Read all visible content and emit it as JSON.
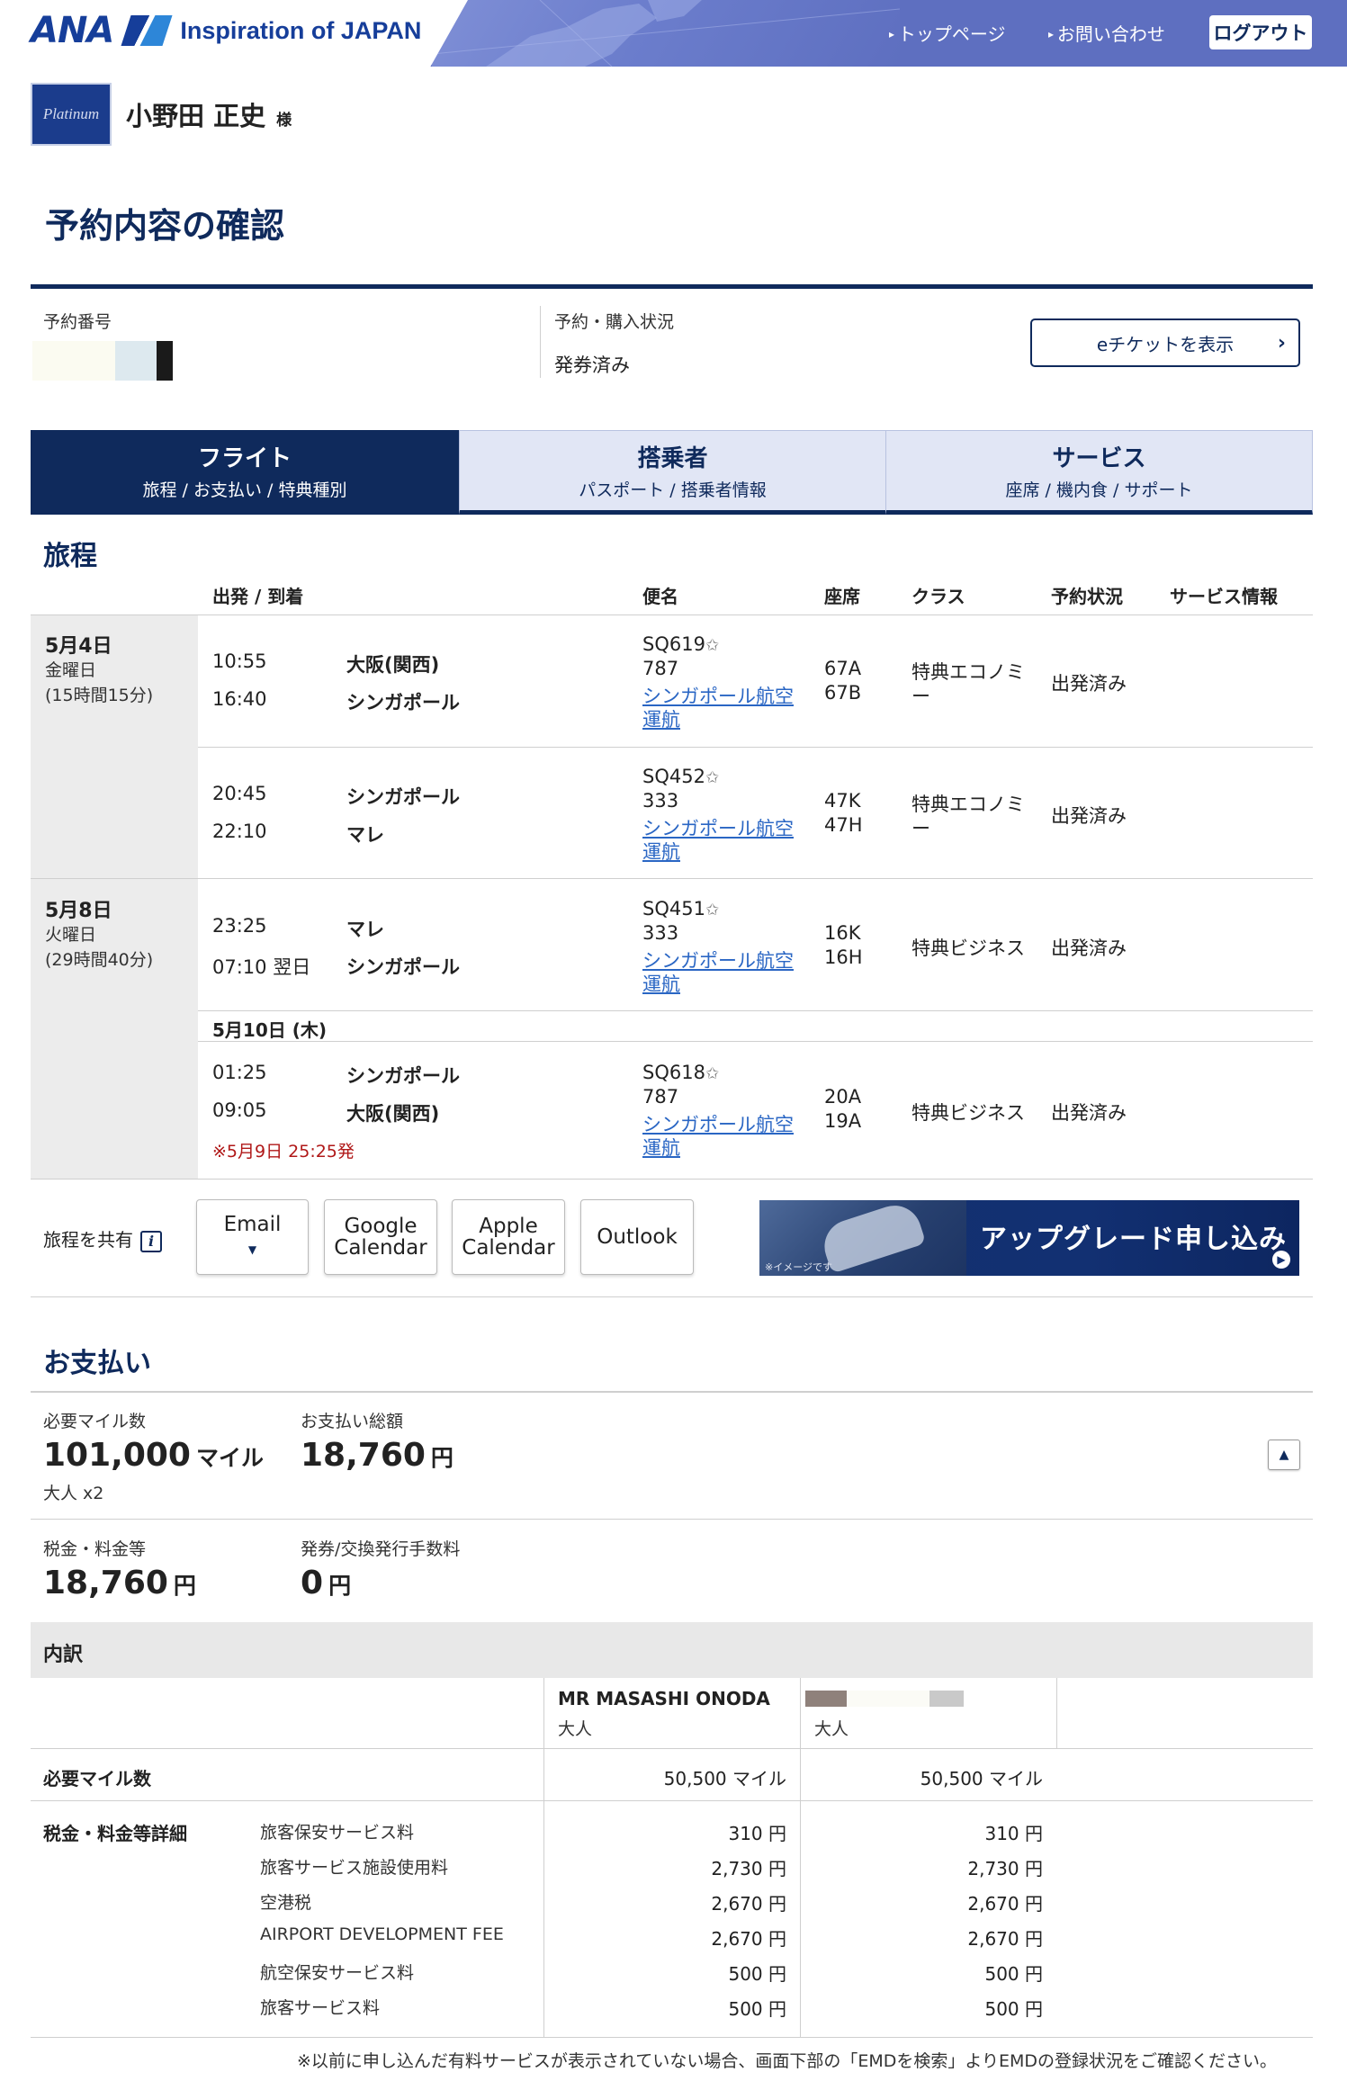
{
  "header": {
    "brand": "ANA",
    "tagline": "Inspiration of JAPAN",
    "links": {
      "top": "トップページ",
      "contact": "お問い合わせ"
    },
    "logout": "ログアウト"
  },
  "user": {
    "badge": "Platinum",
    "name": "小野田 正史",
    "honorific": "様"
  },
  "page_title": "予約内容の確認",
  "booking": {
    "number_label": "予約番号",
    "status_label": "予約・購入状況",
    "status_value": "発券済み",
    "eticket_button": "eチケットを表示"
  },
  "tabs": [
    {
      "title": "フライト",
      "sub": "旅程 / お支払い / 特典種別"
    },
    {
      "title": "搭乗者",
      "sub": "パスポート / 搭乗者情報"
    },
    {
      "title": "サービス",
      "sub": "座席 / 機内食 / サポート"
    }
  ],
  "itinerary": {
    "title": "旅程",
    "headers": {
      "dep_arr": "出発 / 到着",
      "flight": "便名",
      "seat": "座席",
      "class": "クラス",
      "status": "予約状況",
      "service": "サービス情報"
    },
    "days": [
      {
        "date": "5月4日",
        "weekday": "金曜日",
        "duration": "(15時間15分)"
      },
      {
        "date": "5月8日",
        "weekday": "火曜日",
        "duration": "(29時間40分)"
      }
    ],
    "segments": [
      {
        "dep_time": "10:55",
        "dep_city": "大阪(関西)",
        "arr_time": "16:40",
        "arr_city": "シンガポール",
        "flight_no": "SQ619",
        "aircraft": "787",
        "operator_1": "シンガポール航空",
        "operator_2": "運航",
        "seat_1": "67A",
        "seat_2": "67B",
        "class_1": "特典エコノミ",
        "class_2": "ー",
        "status": "出発済み"
      },
      {
        "dep_time": "20:45",
        "dep_city": "シンガポール",
        "arr_time": "22:10",
        "arr_city": "マレ",
        "flight_no": "SQ452",
        "aircraft": "333",
        "operator_1": "シンガポール航空",
        "operator_2": "運航",
        "seat_1": "47K",
        "seat_2": "47H",
        "class_1": "特典エコノミ",
        "class_2": "ー",
        "status": "出発済み"
      },
      {
        "dep_time": "23:25",
        "dep_city": "マレ",
        "arr_time": "07:10 翌日",
        "arr_city": "シンガポール",
        "flight_no": "SQ451",
        "aircraft": "333",
        "operator_1": "シンガポール航空",
        "operator_2": "運航",
        "seat_1": "16K",
        "seat_2": "16H",
        "class_1": "特典ビジネス",
        "class_2": "",
        "status": "出発済み"
      },
      {
        "dep_time": "01:25",
        "dep_city": "シンガポール",
        "arr_time": "09:05",
        "arr_city": "大阪(関西)",
        "flight_no": "SQ618",
        "aircraft": "787",
        "operator_1": "シンガポール航空",
        "operator_2": "運航",
        "seat_1": "20A",
        "seat_2": "19A",
        "class_1": "特典ビジネス",
        "class_2": "",
        "status": "出発済み",
        "note": "※5月9日 25:25発"
      }
    ],
    "date_break": "5月10日 (木)"
  },
  "share": {
    "label": "旅程を共有",
    "info_icon": "i",
    "email": "Email",
    "google_1": "Google",
    "google_2": "Calendar",
    "apple_1": "Apple",
    "apple_2": "Calendar",
    "outlook": "Outlook",
    "upgrade_banner": "アップグレード申し込み",
    "upgrade_note": "※イメージです"
  },
  "payment": {
    "title": "お支払い",
    "miles_label": "必要マイル数",
    "miles_value": "101,000",
    "miles_unit": "マイル",
    "pax": "大人 x2",
    "total_label": "お支払い総額",
    "total_value": "18,760",
    "yen": "円",
    "tax_label": "税金・料金等",
    "tax_value": "18,760",
    "fee_label": "発券/交換発行手数料",
    "fee_value": "0"
  },
  "breakdown": {
    "title": "内訳",
    "passenger_1": "MR MASASHI ONODA",
    "passenger_type": "大人",
    "miles_row_label": "必要マイル数",
    "miles_each": "50,500 マイル",
    "tax_detail_label": "税金・料金等詳細",
    "rows": [
      {
        "name": "旅客保安サービス料",
        "p1": "310 円",
        "p2": "310 円"
      },
      {
        "name": "旅客サービス施設使用料",
        "p1": "2,730 円",
        "p2": "2,730 円"
      },
      {
        "name": "空港税",
        "p1": "2,670 円",
        "p2": "2,670 円"
      },
      {
        "name": "AIRPORT DEVELOPMENT FEE",
        "p1": "2,670 円",
        "p2": "2,670 円"
      },
      {
        "name": "航空保安サービス料",
        "p1": "500 円",
        "p2": "500 円"
      },
      {
        "name": "旅客サービス料",
        "p1": "500 円",
        "p2": "500 円"
      }
    ]
  },
  "footnote": "※以前に申し込んだ有料サービスが表示されていない場合、画面下部の「EMDを検索」よりEMDの登録状況をご確認ください。",
  "colors": {
    "navy": "#0f2a5c",
    "header_blue": "#5e6fc0",
    "tab_inactive": "#e1e6f5",
    "link": "#2a66c4",
    "note_red": "#b01818"
  }
}
